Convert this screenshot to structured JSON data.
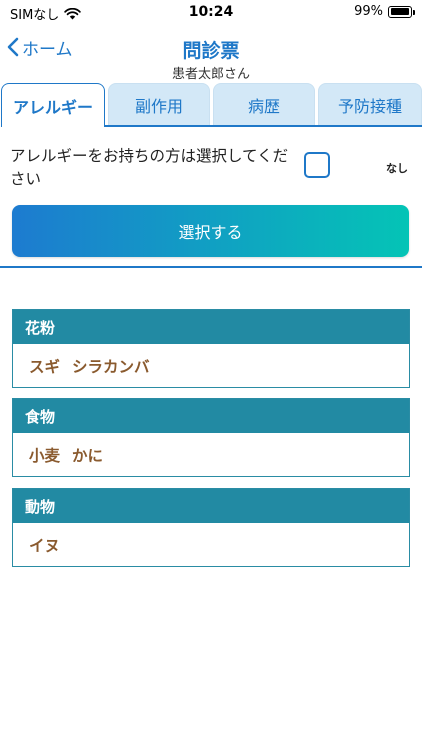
{
  "status": {
    "carrier": "SIMなし",
    "time": "10:24",
    "battery_pct": "99%",
    "battery_level": 0.99
  },
  "nav": {
    "back_label": "ホーム",
    "title": "問診票",
    "subtitle": "患者太郎さん"
  },
  "tabs": [
    {
      "label": "アレルギー",
      "active": true
    },
    {
      "label": "副作用",
      "active": false
    },
    {
      "label": "病歴",
      "active": false
    },
    {
      "label": "予防接種",
      "active": false
    }
  ],
  "allergy_prompt": "アレルギーをお持ちの方は選択してください",
  "none_label": "なし",
  "select_button": "選択する",
  "categories": [
    {
      "title": "花粉",
      "items": [
        "スギ",
        "シラカンバ"
      ]
    },
    {
      "title": "食物",
      "items": [
        "小麦",
        "かに"
      ]
    },
    {
      "title": "動物",
      "items": [
        "イヌ"
      ]
    }
  ],
  "colors": {
    "accent": "#1f78c8",
    "card_header": "#228aa3",
    "item_text": "#8a5a2e",
    "gradient_start": "#1d7bd0",
    "gradient_end": "#04c4b6"
  }
}
